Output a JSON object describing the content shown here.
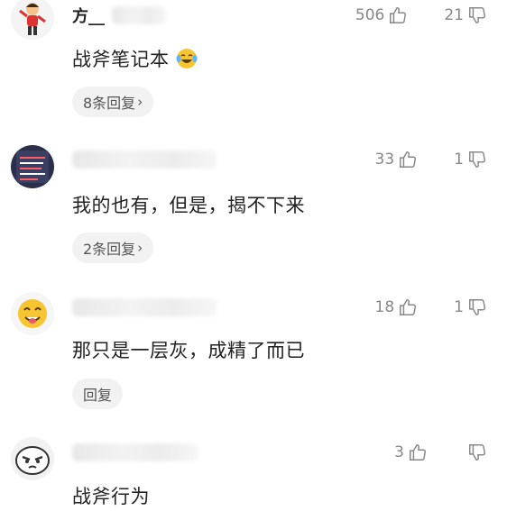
{
  "comments": [
    {
      "username": "方__",
      "likes": "506",
      "dislikes": "21",
      "text": "战斧笔记本",
      "reply_label": "8条回复"
    },
    {
      "username": "",
      "likes": "33",
      "dislikes": "1",
      "text": "我的也有，但是，揭不下来",
      "reply_label": "2条回复"
    },
    {
      "username": "",
      "likes": "18",
      "dislikes": "1",
      "text": "那只是一层灰，成精了而已",
      "reply_label": "回复"
    },
    {
      "username": "",
      "likes": "3",
      "dislikes": "",
      "text": "战斧行为",
      "reply_label": ""
    }
  ],
  "icons": {
    "like": "thumbs-up-icon",
    "dislike": "thumbs-down-icon",
    "emoji": "laughing-tears-emoji-icon",
    "chevron": "chevron-right-icon"
  },
  "colors": {
    "text": "#222222",
    "meta": "#888888",
    "pill_bg": "#f2f2f2"
  }
}
